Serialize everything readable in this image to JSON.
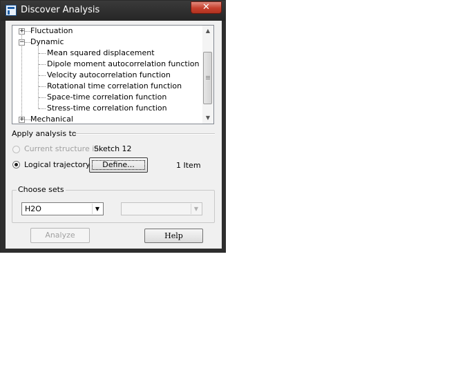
{
  "window": {
    "title": "Discover Analysis",
    "close_symbol": "✕"
  },
  "tree": {
    "items": [
      {
        "label": "Fluctuation",
        "expander": "+"
      },
      {
        "label": "Dynamic",
        "expander": "−"
      },
      {
        "label": "Mean squared displacement",
        "selected": true
      },
      {
        "label": "Dipole moment autocorrelation function"
      },
      {
        "label": "Velocity autocorrelation function"
      },
      {
        "label": "Rotational time correlation function"
      },
      {
        "label": "Space-time correlation function"
      },
      {
        "label": "Stress-time correlation function"
      },
      {
        "label": "Mechanical",
        "expander": "+"
      }
    ],
    "scroll_up": "▲",
    "scroll_down": "▼"
  },
  "apply": {
    "heading": "Apply analysis to",
    "current_structure_label": "Current structure in",
    "current_structure_value": "Sketch 12",
    "logical_trajectory_label": "Logical trajectory",
    "define_button": "Define...",
    "item_count": "1 Item"
  },
  "sets": {
    "heading": "Choose sets",
    "set1_value": "H2O",
    "set2_value": "",
    "arrow": "▼"
  },
  "buttons": {
    "analyze": "Analyze",
    "help": "Help"
  }
}
